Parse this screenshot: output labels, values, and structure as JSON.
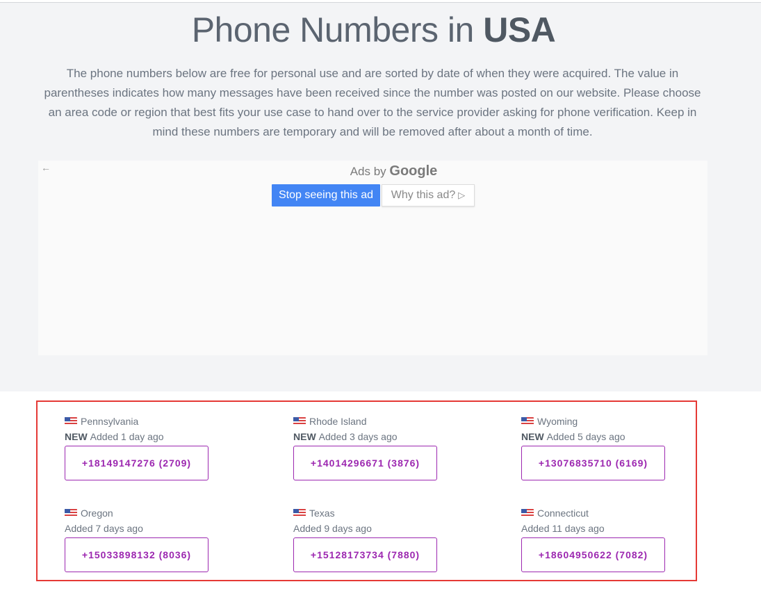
{
  "header": {
    "title_prefix": "Phone Numbers in ",
    "title_country": "USA",
    "intro": "The phone numbers below are free for personal use and are sorted by date of when they were acquired. The value in parentheses indicates how many messages have been received since the number was posted on our website. Please choose an area code or region that best fits your use case to hand over to the service provider asking for phone verification. Keep in mind these numbers are temporary and will be removed after about a month of time."
  },
  "ad": {
    "ads_by": "Ads by",
    "google": "Google",
    "stop_label": "Stop seeing this ad",
    "why_label": "Why this ad?",
    "back_icon": "←",
    "play_icon": "▷"
  },
  "numbers": [
    {
      "region": "Pennsylvania",
      "new_badge": "NEW",
      "added": "Added 1 day ago",
      "number": "+18149147276 (2709)"
    },
    {
      "region": "Rhode Island",
      "new_badge": "NEW",
      "added": "Added 3 days ago",
      "number": "+14014296671 (3876)"
    },
    {
      "region": "Wyoming",
      "new_badge": "NEW",
      "added": "Added 5 days ago",
      "number": "+13076835710 (6169)"
    },
    {
      "region": "Oregon",
      "new_badge": "",
      "added": "Added 7 days ago",
      "number": "+15033898132 (8036)"
    },
    {
      "region": "Texas",
      "new_badge": "",
      "added": "Added 9 days ago",
      "number": "+15128173734 (7880)"
    },
    {
      "region": "Connecticut",
      "new_badge": "",
      "added": "Added 11 days ago",
      "number": "+18604950622 (7082)"
    }
  ],
  "colors": {
    "accent": "#9c27b0",
    "highlight": "#e53935",
    "ad_button": "#4285f4"
  }
}
